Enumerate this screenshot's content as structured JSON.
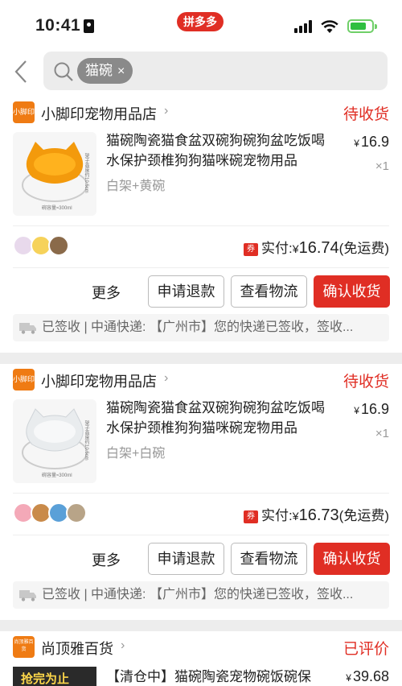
{
  "status_bar": {
    "time": "10:41",
    "app_badge": "拼多多"
  },
  "search": {
    "chip_text": "猫碗",
    "chip_close": "×"
  },
  "orders": [
    {
      "shop_logo": "小脚印",
      "shop_name": "小脚印宠物用品店",
      "status": "待收货",
      "title": "猫碗陶瓷猫食盆双碗狗碗狗盆吃饭喝水保护颈椎狗狗猫咪碗宠物用品",
      "variant": "白架+黄碗",
      "price_symbol": "¥",
      "price": "16.9",
      "qty": "×1",
      "thumb_caption": "碗容量≈300ml",
      "thumb_side": "架子高度约10.5cm",
      "paid_label": "实付:",
      "paid_symbol": "¥",
      "paid_amount": "16.74",
      "shipping": "(免运费)",
      "coupon_icon": "券",
      "more": "更多",
      "btn_refund": "申请退款",
      "btn_logistics": "查看物流",
      "btn_confirm": "确认收货",
      "logistics_text": "已签收 | 中通快递: 【广州市】您的快递已签收，签收..."
    },
    {
      "shop_logo": "小脚印",
      "shop_name": "小脚印宠物用品店",
      "status": "待收货",
      "title": "猫碗陶瓷猫食盆双碗狗碗狗盆吃饭喝水保护颈椎狗狗猫咪碗宠物用品",
      "variant": "白架+白碗",
      "price_symbol": "¥",
      "price": "16.9",
      "qty": "×1",
      "thumb_caption": "碗容量≈300ml",
      "thumb_side": "架子高度约10.5cm",
      "thumb_size": "15cm",
      "paid_label": "实付:",
      "paid_symbol": "¥",
      "paid_amount": "16.73",
      "shipping": "(免运费)",
      "coupon_icon": "券",
      "more": "更多",
      "btn_refund": "申请退款",
      "btn_logistics": "查看物流",
      "btn_confirm": "确认收货",
      "logistics_text": "已签收 | 中通快递: 【广州市】您的快递已签收，签收..."
    },
    {
      "shop_logo": "尚顶雅百货",
      "shop_name": "尚顶雅百货",
      "status": "已评价",
      "title": "【清仓中】猫碗陶瓷宠物碗饭碗保",
      "price_symbol": "¥",
      "price": "39.68",
      "promo_text": "抢完为止"
    }
  ],
  "colors": {
    "accent": "#e02e24",
    "shop_orange": "#ef7b13"
  },
  "icons": [
    "back-icon",
    "search-icon",
    "close-icon",
    "chevron-right-icon",
    "truck-icon",
    "coupon-icon"
  ]
}
